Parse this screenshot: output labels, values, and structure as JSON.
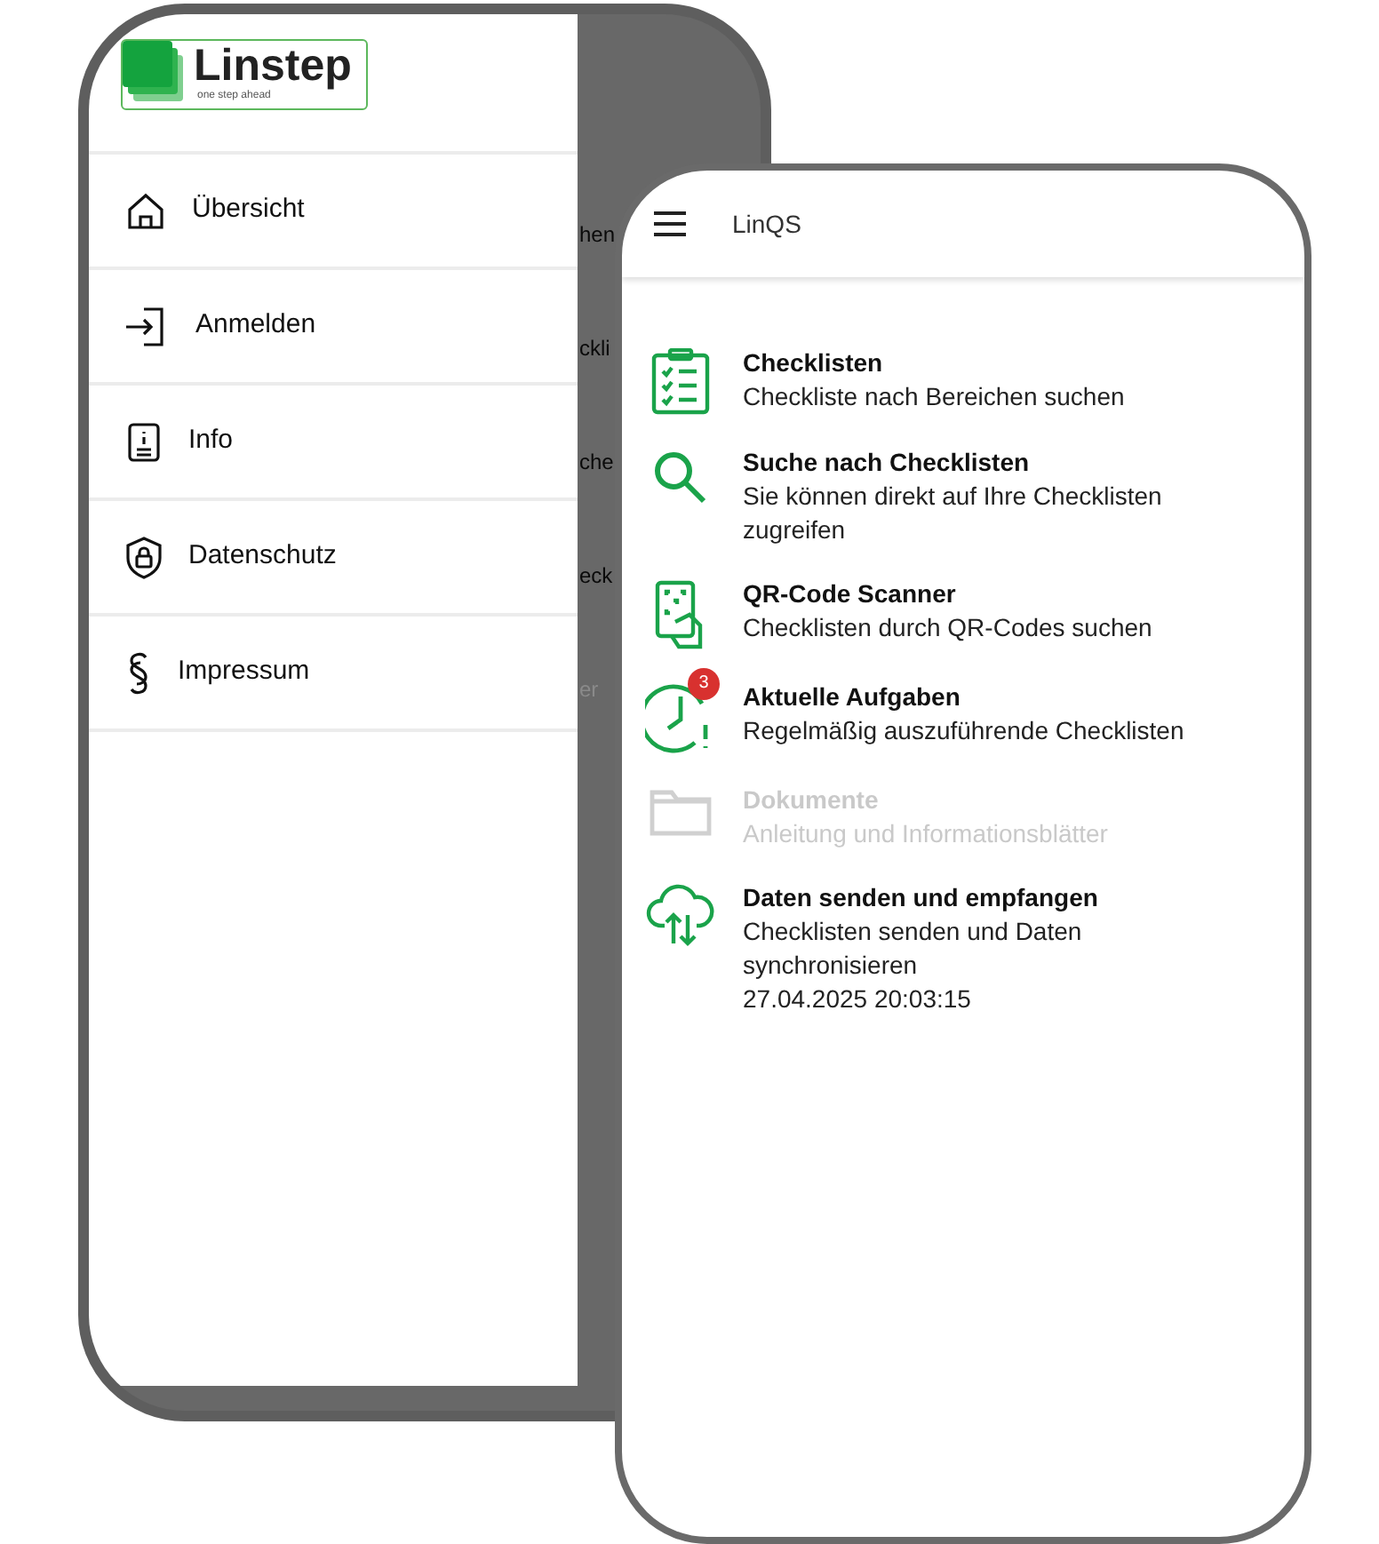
{
  "left_phone": {
    "logo": {
      "name": "Linstep",
      "tagline": "one step ahead"
    },
    "drawer_items": [
      {
        "label": "Übersicht",
        "kind": "home"
      },
      {
        "label": "Anmelden",
        "kind": "login"
      },
      {
        "label": "Info",
        "kind": "info"
      },
      {
        "label": "Datenschutz",
        "kind": "privacy"
      },
      {
        "label": "Impressum",
        "kind": "imprint"
      }
    ],
    "background_fragments": [
      "hen",
      "ckli",
      "che",
      "eck",
      "er"
    ]
  },
  "right_phone": {
    "app_bar": {
      "title": "LinQS"
    },
    "items": [
      {
        "kind": "checklists",
        "title": "Checklisten",
        "subtitle": "Checkliste nach Bereichen suchen",
        "disabled": false
      },
      {
        "kind": "search",
        "title": "Suche nach Checklisten",
        "subtitle": "Sie können direkt auf Ihre Checklisten zugreifen",
        "disabled": false
      },
      {
        "kind": "scanner",
        "title": "QR-Code Scanner",
        "subtitle": "Checklisten durch QR-Codes suchen",
        "disabled": false
      },
      {
        "kind": "tasks",
        "title": "Aktuelle Aufgaben",
        "subtitle": "Regelmäßig auszuführende Checklisten",
        "badge": "3",
        "disabled": false
      },
      {
        "kind": "documents",
        "title": "Dokumente",
        "subtitle": "Anleitung und Informationsblätter",
        "disabled": true
      },
      {
        "kind": "sync",
        "title": "Daten senden und empfangen",
        "subtitle": "Checklisten senden und Daten synchronisieren",
        "timestamp": "27.04.2025 20:03:15",
        "disabled": false
      }
    ]
  }
}
